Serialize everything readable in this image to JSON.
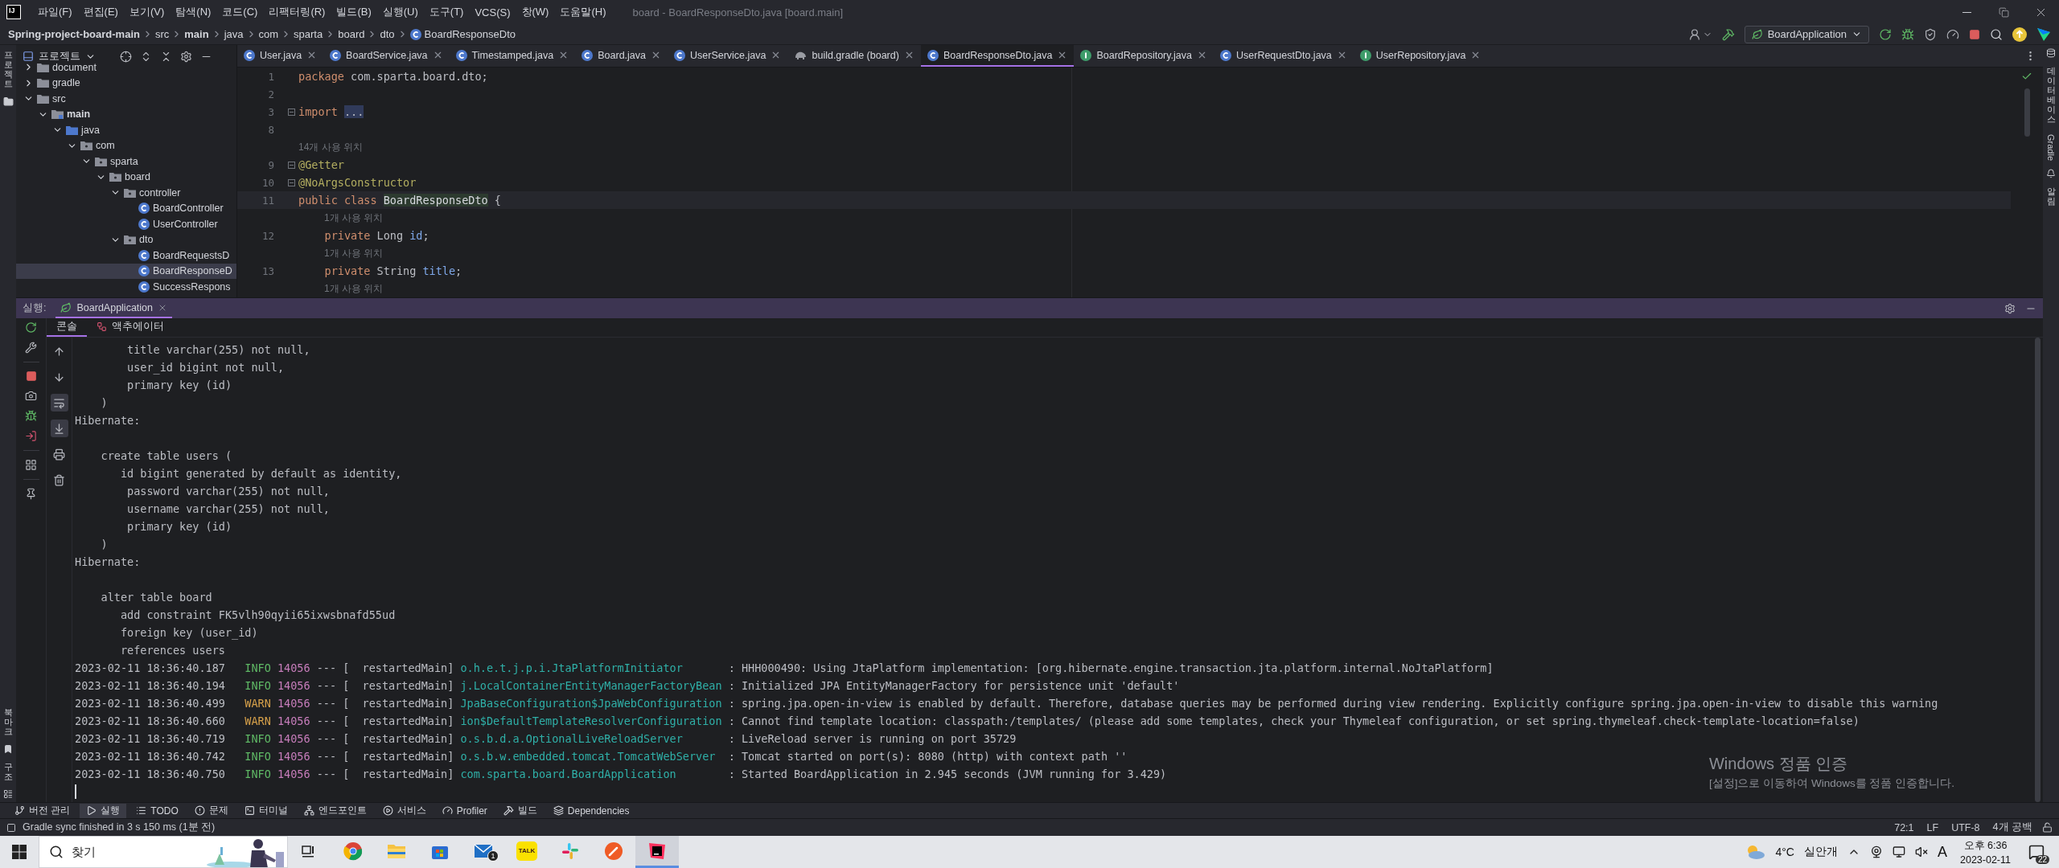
{
  "window": {
    "logo": "IJ",
    "title": "board - BoardResponseDto.java [board.main]"
  },
  "menu": [
    "파일(F)",
    "편집(E)",
    "보기(V)",
    "탐색(N)",
    "코드(C)",
    "리팩터링(R)",
    "빌드(B)",
    "실행(U)",
    "도구(T)",
    "VCS(S)",
    "창(W)",
    "도움말(H)"
  ],
  "breadcrumbs": [
    {
      "label": "Spring-project-board-main",
      "kind": "project"
    },
    {
      "label": "src",
      "kind": "folder"
    },
    {
      "label": "main",
      "kind": "module"
    },
    {
      "label": "java",
      "kind": "folder"
    },
    {
      "label": "com",
      "kind": "folder"
    },
    {
      "label": "sparta",
      "kind": "folder"
    },
    {
      "label": "board",
      "kind": "folder"
    },
    {
      "label": "dto",
      "kind": "folder"
    },
    {
      "label": "BoardResponseDto",
      "kind": "class"
    }
  ],
  "toolbar": {
    "run_config": "BoardApplication"
  },
  "left_strip": {
    "top": {
      "label": "프로젝트",
      "kind": "stacked"
    },
    "bottom": [
      {
        "label": "북마크",
        "kind": "stacked"
      },
      {
        "label": "구조",
        "kind": "stacked"
      }
    ]
  },
  "right_strip": [
    {
      "label": "데이터베이스",
      "kind": "stacked"
    },
    {
      "label": "Gradle",
      "kind": "rotated"
    },
    {
      "label": "알림",
      "kind": "stacked"
    }
  ],
  "project_panel": {
    "title": "프로젝트",
    "tree": [
      {
        "label": "document",
        "kind": "folder",
        "expanded": false,
        "selected": false
      },
      {
        "label": "gradle",
        "kind": "folder",
        "expanded": false,
        "selected": false
      },
      {
        "label": "src",
        "kind": "folder",
        "expanded": true,
        "selected": false,
        "children": [
          {
            "label": "main",
            "kind": "module",
            "expanded": true,
            "selected": false,
            "children": [
              {
                "label": "java",
                "kind": "source",
                "expanded": true,
                "selected": false,
                "children": [
                  {
                    "label": "com",
                    "kind": "package",
                    "expanded": true,
                    "selected": false,
                    "children": [
                      {
                        "label": "sparta",
                        "kind": "package",
                        "expanded": true,
                        "selected": false,
                        "children": [
                          {
                            "label": "board",
                            "kind": "package",
                            "expanded": true,
                            "selected": false,
                            "children": [
                              {
                                "label": "controller",
                                "kind": "package",
                                "expanded": true,
                                "selected": false,
                                "children": [
                                  {
                                    "label": "BoardController",
                                    "kind": "class",
                                    "selected": false
                                  },
                                  {
                                    "label": "UserController",
                                    "kind": "class",
                                    "selected": false
                                  }
                                ]
                              },
                              {
                                "label": "dto",
                                "kind": "package",
                                "expanded": true,
                                "selected": false,
                                "children": [
                                  {
                                    "label": "BoardRequestsD",
                                    "kind": "class",
                                    "selected": false
                                  },
                                  {
                                    "label": "BoardResponseD",
                                    "kind": "class",
                                    "selected": true
                                  },
                                  {
                                    "label": "SuccessRespons",
                                    "kind": "class",
                                    "selected": false
                                  }
                                ]
                              }
                            ]
                          }
                        ]
                      }
                    ]
                  }
                ]
              }
            ]
          }
        ]
      }
    ]
  },
  "editor": {
    "tabs": [
      {
        "label": "User.java",
        "kind": "class",
        "selected": false
      },
      {
        "label": "BoardService.java",
        "kind": "class",
        "selected": false
      },
      {
        "label": "Timestamped.java",
        "kind": "class",
        "selected": false
      },
      {
        "label": "Board.java",
        "kind": "class",
        "selected": false
      },
      {
        "label": "UserService.java",
        "kind": "class",
        "selected": false
      },
      {
        "label": "build.gradle (board)",
        "kind": "gradle",
        "selected": false
      },
      {
        "label": "BoardResponseDto.java",
        "kind": "class",
        "selected": true
      },
      {
        "label": "BoardRepository.java",
        "kind": "interface",
        "selected": false
      },
      {
        "label": "UserRequestDto.java",
        "kind": "class",
        "selected": false
      },
      {
        "label": "UserRepository.java",
        "kind": "interface",
        "selected": false
      }
    ],
    "lines": [
      {
        "kind": "code",
        "number": "1",
        "current": false,
        "fold": false,
        "tokens": [
          {
            "kind": "keyword",
            "text": "package"
          },
          {
            "kind": "plain",
            "text": " com.sparta.board.dto;"
          }
        ]
      },
      {
        "kind": "code",
        "number": "2",
        "current": false,
        "fold": false
      },
      {
        "kind": "code",
        "number": "3",
        "current": false,
        "fold": true,
        "tokens": [
          {
            "kind": "keyword",
            "text": "import"
          },
          {
            "kind": "folded",
            "text": "..."
          }
        ]
      },
      {
        "kind": "code",
        "number": "8",
        "current": false,
        "fold": false
      },
      {
        "kind": "hint",
        "text": "14개 사용 위치",
        "nested": false
      },
      {
        "kind": "code",
        "number": "9",
        "current": false,
        "fold": true,
        "tokens": [
          {
            "kind": "annotation",
            "text": "@Getter"
          }
        ]
      },
      {
        "kind": "code",
        "number": "10",
        "current": false,
        "fold": true,
        "tokens": [
          {
            "kind": "annotation",
            "text": "@NoArgsConstructor"
          }
        ]
      },
      {
        "kind": "code",
        "number": "11",
        "current": true,
        "fold": false,
        "tokens": [
          {
            "kind": "keyword",
            "text": "public class"
          },
          {
            "kind": "declaration",
            "text": "BoardResponseDto"
          },
          {
            "kind": "plain",
            "text": " {"
          }
        ]
      },
      {
        "kind": "hint",
        "text": "1개 사용 위치",
        "nested": true
      },
      {
        "kind": "code",
        "number": "12",
        "current": false,
        "fold": false,
        "tokens": [
          {
            "kind": "keyword",
            "text": "    private"
          },
          {
            "kind": "plain",
            "text": " Long "
          },
          {
            "kind": "field",
            "text": "id"
          },
          {
            "kind": "plain",
            "text": ";"
          }
        ]
      },
      {
        "kind": "hint",
        "text": "1개 사용 위치",
        "nested": true
      },
      {
        "kind": "code",
        "number": "13",
        "current": false,
        "fold": false,
        "tokens": [
          {
            "kind": "keyword",
            "text": "    private"
          },
          {
            "kind": "plain",
            "text": " String "
          },
          {
            "kind": "field",
            "text": "title"
          },
          {
            "kind": "plain",
            "text": ";"
          }
        ]
      },
      {
        "kind": "hint",
        "text": "1개 사용 위치",
        "nested": true
      }
    ]
  },
  "run_panel": {
    "label": "실행:",
    "tabs": [
      {
        "label": "BoardApplication",
        "selected": true
      }
    ],
    "subtabs": [
      {
        "label": "콘솔",
        "kind": "plain",
        "selected": true
      },
      {
        "label": "액추에이터",
        "kind": "actuator",
        "selected": false
      }
    ],
    "console_tools": [
      {
        "kind": "up",
        "on": false
      },
      {
        "kind": "down",
        "on": false
      },
      {
        "kind": "wrap",
        "on": true
      },
      {
        "kind": "scroll_end",
        "on": true
      },
      {
        "kind": "print",
        "on": false
      },
      {
        "kind": "trash",
        "on": false
      }
    ]
  },
  "console": {
    "lines_before": [
      "        title varchar(255) not null,",
      "        user_id bigint not null,",
      "        primary key (id)",
      "    )"
    ],
    "statements": [
      {
        "header": "Hibernate: ",
        "lines": [
          "    create table users (",
          "       id bigint generated by default as identity,",
          "        password varchar(255) not null,",
          "        username varchar(255) not null,",
          "        primary key (id)",
          "    )"
        ]
      },
      {
        "header": "Hibernate: ",
        "lines": [
          "    alter table board",
          "       add constraint FK5vlh90qyii65ixwsbnafd55ud",
          "       foreign key (user_id)",
          "       references users"
        ]
      }
    ],
    "log": [
      {
        "time": "2023-02-11 18:36:40.187",
        "level": "INFO",
        "kind": "info",
        "pid": "14056",
        "dashes": "---",
        "thread": "[  restartedMain]",
        "logger": "o.h.e.t.j.p.i.JtaPlatformInitiator",
        "message": ": HHH000490: Using JtaPlatform implementation: [org.hibernate.engine.transaction.jta.platform.internal.NoJtaPlatform]"
      },
      {
        "time": "2023-02-11 18:36:40.194",
        "level": "INFO",
        "kind": "info",
        "pid": "14056",
        "dashes": "---",
        "thread": "[  restartedMain]",
        "logger": "j.LocalContainerEntityManagerFactoryBean",
        "message": ": Initialized JPA EntityManagerFactory for persistence unit 'default'"
      },
      {
        "time": "2023-02-11 18:36:40.499",
        "level": "WARN",
        "kind": "warn",
        "pid": "14056",
        "dashes": "---",
        "thread": "[  restartedMain]",
        "logger": "JpaBaseConfiguration$JpaWebConfiguration",
        "message": ": spring.jpa.open-in-view is enabled by default. Therefore, database queries may be performed during view rendering. Explicitly configure spring.jpa.open-in-view to disable this warning"
      },
      {
        "time": "2023-02-11 18:36:40.660",
        "level": "WARN",
        "kind": "warn",
        "pid": "14056",
        "dashes": "---",
        "thread": "[  restartedMain]",
        "logger": "ion$DefaultTemplateResolverConfiguration",
        "message": ": Cannot find template location: classpath:/templates/ (please add some templates, check your Thymeleaf configuration, or set spring.thymeleaf.check-template-location=false)"
      },
      {
        "time": "2023-02-11 18:36:40.719",
        "level": "INFO",
        "kind": "info",
        "pid": "14056",
        "dashes": "---",
        "thread": "[  restartedMain]",
        "logger": "o.s.b.d.a.OptionalLiveReloadServer",
        "message": ": LiveReload server is running on port 35729"
      },
      {
        "time": "2023-02-11 18:36:40.742",
        "level": "INFO",
        "kind": "info",
        "pid": "14056",
        "dashes": "---",
        "thread": "[  restartedMain]",
        "logger": "o.s.b.w.embedded.tomcat.TomcatWebServer",
        "message": ": Tomcat started on port(s): 8080 (http) with context path ''"
      },
      {
        "time": "2023-02-11 18:36:40.750",
        "level": "INFO",
        "kind": "info",
        "pid": "14056",
        "dashes": "---",
        "thread": "[  restartedMain]",
        "logger": "com.sparta.board.BoardApplication",
        "message": ": Started BoardApplication in 2.945 seconds (JVM running for 3.429)"
      }
    ]
  },
  "activation": {
    "title": "Windows 정품 인증",
    "message": "[설정]으로 이동하여 Windows를 정품 인증합니다."
  },
  "bottom_tools": [
    {
      "label": "버전 관리",
      "kind": "branch",
      "selected": false
    },
    {
      "label": "실행",
      "kind": "run",
      "selected": true
    },
    {
      "label": "TODO",
      "kind": "todo",
      "selected": false
    },
    {
      "label": "문제",
      "kind": "problems",
      "selected": false
    },
    {
      "label": "터미널",
      "kind": "terminal",
      "selected": false
    },
    {
      "label": "엔드포인트",
      "kind": "endpoints",
      "selected": false
    },
    {
      "label": "서비스",
      "kind": "services",
      "selected": false
    },
    {
      "label": "Profiler",
      "kind": "profiler",
      "selected": false
    },
    {
      "label": "빌드",
      "kind": "build",
      "selected": false
    },
    {
      "label": "Dependencies",
      "kind": "dependencies",
      "selected": false
    }
  ],
  "status_bar": {
    "message": "Gradle sync finished in 3 s 150 ms (1분 전)",
    "position": "72:1",
    "line_ending": "LF",
    "encoding": "UTF-8",
    "indent": "4개 공백"
  },
  "taskbar": {
    "search_placeholder": "찾기",
    "apps": [
      {
        "kind": "taskview",
        "selected": false
      },
      {
        "kind": "chrome",
        "selected": false
      },
      {
        "kind": "explorer",
        "selected": false
      },
      {
        "kind": "store",
        "selected": false
      },
      {
        "kind": "mail",
        "badge": "1",
        "selected": false
      },
      {
        "kind": "kakao",
        "label": "TALK",
        "selected": false
      },
      {
        "kind": "slack",
        "selected": false
      },
      {
        "kind": "pen",
        "selected": false
      },
      {
        "kind": "intellij",
        "selected": true
      }
    ],
    "weather": {
      "temperature": "4°C",
      "condition": "실안개"
    },
    "ime": "A",
    "time": "오후 6:36",
    "date": "2023-02-11",
    "notifications": "22"
  }
}
